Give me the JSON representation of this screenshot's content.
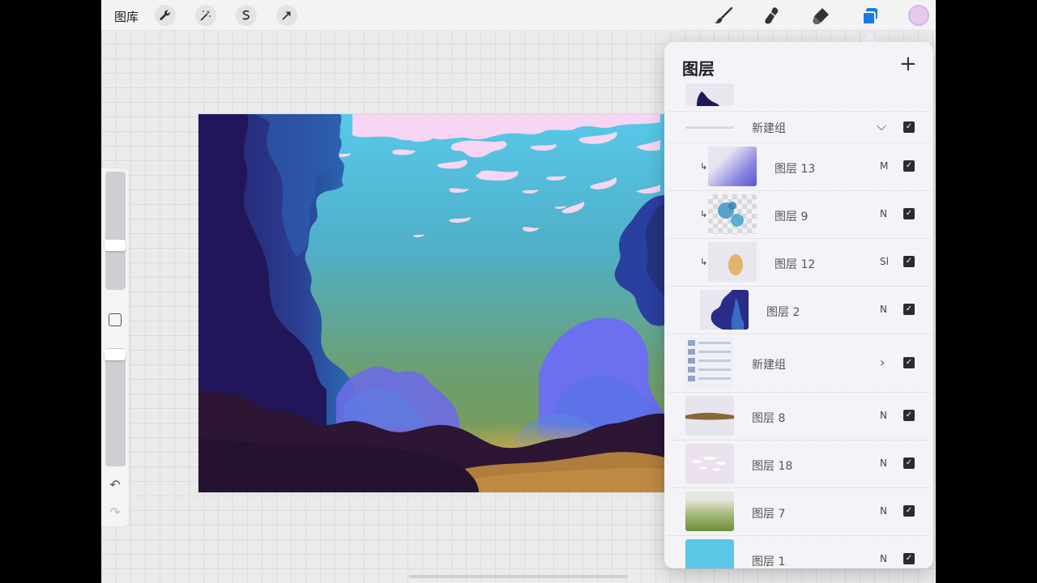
{
  "toolbar": {
    "gallery_label": "图库",
    "actions": [
      "wrench-icon",
      "magic-wand-icon",
      "selection-icon",
      "transform-icon"
    ],
    "tools": [
      "brush-icon",
      "smudge-icon",
      "eraser-icon",
      "layers-icon"
    ],
    "active_tool": "layers-icon",
    "current_color": "#e7c8ef"
  },
  "sidebar": {
    "brush_size_level": 0.3,
    "opacity_level": 0.95,
    "icons": [
      "modify-square-icon",
      "undo-icon",
      "redo-icon"
    ]
  },
  "layers_panel": {
    "title": "图层",
    "add_icon": "plus-icon",
    "layers": [
      {
        "name": "新建组",
        "type": "group",
        "expanded": true,
        "mode": "",
        "visible": true
      },
      {
        "name": "图层 13",
        "type": "layer",
        "clipped": true,
        "mode": "M",
        "visible": true
      },
      {
        "name": "图层 9",
        "type": "layer",
        "clipped": true,
        "mode": "N",
        "visible": true
      },
      {
        "name": "图层 12",
        "type": "layer",
        "clipped": true,
        "mode": "Sl",
        "visible": true
      },
      {
        "name": "图层 2",
        "type": "layer",
        "clipped": false,
        "mode": "N",
        "visible": true
      },
      {
        "name": "新建组",
        "type": "group",
        "expanded": false,
        "mode": "",
        "visible": true
      },
      {
        "name": "图层 8",
        "type": "layer",
        "clipped": false,
        "mode": "N",
        "visible": true
      },
      {
        "name": "图层 18",
        "type": "layer",
        "clipped": false,
        "mode": "N",
        "visible": true
      },
      {
        "name": "图层 7",
        "type": "layer",
        "clipped": false,
        "mode": "N",
        "visible": true
      },
      {
        "name": "图层 1",
        "type": "layer",
        "clipped": false,
        "mode": "N",
        "visible": true
      }
    ]
  },
  "colors": {
    "sky_top": "#5cc6e6",
    "sky_bottom": "#6fa25a",
    "foliage_dark": "#2a2470",
    "foliage_blue": "#2c6fb8",
    "foliage_purple": "#6b6fe8",
    "ground": "#2a1430",
    "path": "#b3823e",
    "clouds": "#f3d7f2"
  }
}
